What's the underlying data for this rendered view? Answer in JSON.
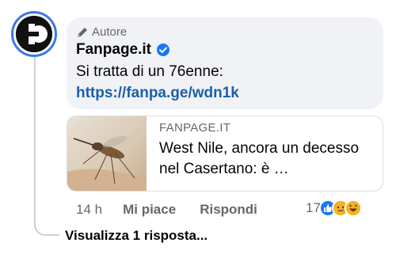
{
  "comment": {
    "author_badge": "Autore",
    "page_name": "Fanpage.it",
    "text": "Si tratta di un 76enne:",
    "link": "https://fanpa.ge/wdn1k"
  },
  "link_preview": {
    "domain": "FANPAGE.IT",
    "title": "West Nile, ancora un decesso nel Casertano: è …"
  },
  "actions": {
    "time": "14 h",
    "like": "Mi piace",
    "reply": "Rispondi",
    "reaction_count": "17"
  },
  "reactions": [
    "like-icon",
    "sad-icon",
    "haha-icon"
  ],
  "view_replies": "Visualizza 1 risposta...",
  "colors": {
    "link": "#1b5fa8",
    "bubble": "#f0f2f5",
    "secondary_text": "#65676b",
    "verified": "#1877f2",
    "avatar_ring": "#3b78e7"
  }
}
